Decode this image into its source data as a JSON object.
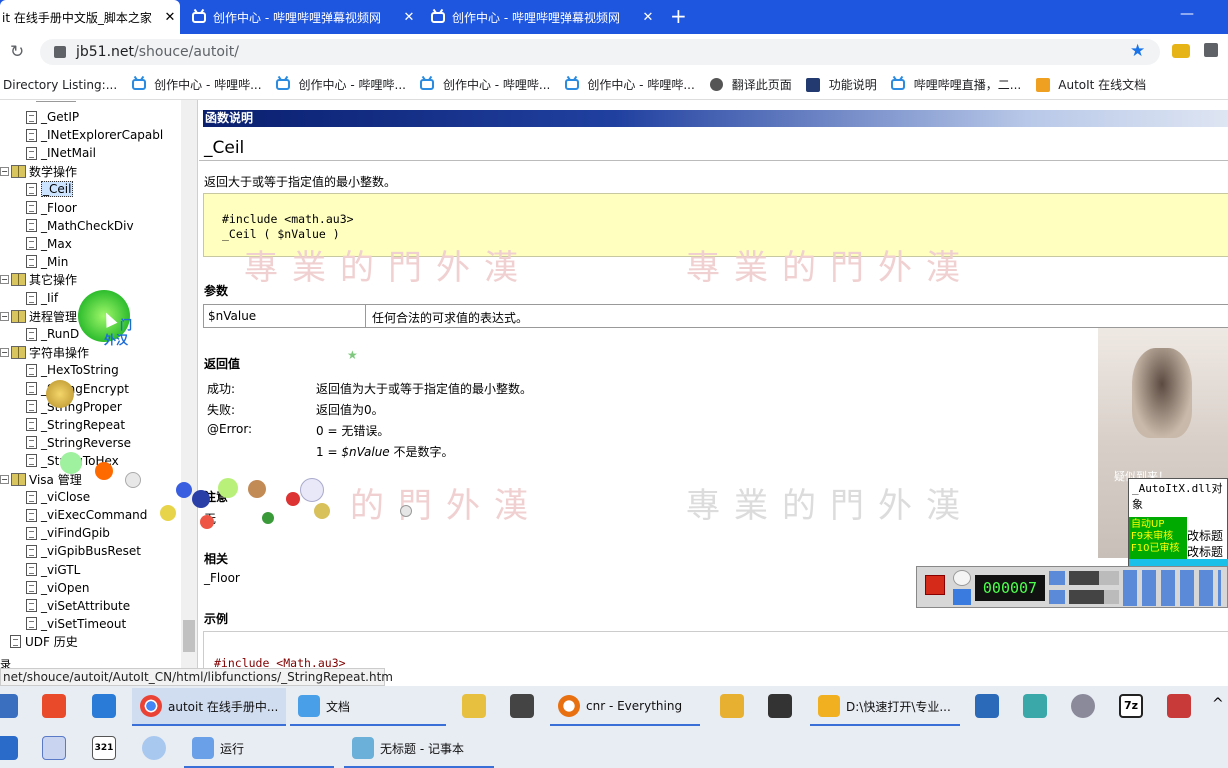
{
  "browser": {
    "tabs": [
      {
        "label": "it 在线手册中文版_脚本之家",
        "close": "✕",
        "active": true
      },
      {
        "label": "创作中心 - 哔哩哔哩弹幕视频网",
        "close": "✕",
        "active": false
      },
      {
        "label": "创作中心 - 哔哩哔哩弹幕视频网",
        "close": "✕",
        "active": false
      }
    ],
    "new_tab": "+",
    "window_minimize": "—",
    "address": {
      "host": "jb51.net",
      "path": "/shouce/autoit/"
    },
    "bookmarks": [
      {
        "label": "Directory Listing:...",
        "icon": "none"
      },
      {
        "label": "创作中心 - 哔哩哔...",
        "icon": "bilibili-icon"
      },
      {
        "label": "创作中心 - 哔哩哔...",
        "icon": "bilibili-icon"
      },
      {
        "label": "创作中心 - 哔哩哔...",
        "icon": "bilibili-icon"
      },
      {
        "label": "创作中心 - 哔哩哔...",
        "icon": "bilibili-icon"
      },
      {
        "label": "翻译此页面",
        "icon": "translate-icon"
      },
      {
        "label": "功能说明",
        "icon": "ru-icon"
      },
      {
        "label": "哔哩哔哩直播，二...",
        "icon": "bilibili-icon"
      },
      {
        "label": "AutoIt 在线文档",
        "icon": "autoit-icon"
      }
    ]
  },
  "tree": {
    "items": [
      {
        "label": "_GetIP",
        "type": "doc"
      },
      {
        "label": "_INetExplorerCapabl",
        "type": "doc"
      },
      {
        "label": "_INetMail",
        "type": "doc"
      },
      {
        "label": "数学操作",
        "type": "folder"
      },
      {
        "label": "_Ceil",
        "type": "doc",
        "selected": true
      },
      {
        "label": "_Floor",
        "type": "doc"
      },
      {
        "label": "_MathCheckDiv",
        "type": "doc"
      },
      {
        "label": "_Max",
        "type": "doc"
      },
      {
        "label": "_Min",
        "type": "doc"
      },
      {
        "label": "其它操作",
        "type": "folder"
      },
      {
        "label": "_Iif",
        "type": "doc"
      },
      {
        "label": "进程管理",
        "type": "folder"
      },
      {
        "label": "_RunD",
        "type": "doc"
      },
      {
        "label": "字符串操作",
        "type": "folder"
      },
      {
        "label": "_HexToString",
        "type": "doc"
      },
      {
        "label": "_StringEncrypt",
        "type": "doc"
      },
      {
        "label": "_StringProper",
        "type": "doc"
      },
      {
        "label": "_StringRepeat",
        "type": "doc"
      },
      {
        "label": "_StringReverse",
        "type": "doc"
      },
      {
        "label": "_StringToHex",
        "type": "doc"
      },
      {
        "label": "Visa 管理",
        "type": "folder"
      },
      {
        "label": "_viClose",
        "type": "doc"
      },
      {
        "label": "_viExecCommand",
        "type": "doc"
      },
      {
        "label": "_viFindGpib",
        "type": "doc"
      },
      {
        "label": "_viGpibBusReset",
        "type": "doc"
      },
      {
        "label": "_viGTL",
        "type": "doc"
      },
      {
        "label": "_viOpen",
        "type": "doc"
      },
      {
        "label": "_viSetAttribute",
        "type": "doc"
      },
      {
        "label": "_viSetTimeout",
        "type": "doc"
      },
      {
        "label": "UDF 历史",
        "type": "doc"
      }
    ],
    "bottom_fragment": "录"
  },
  "doc": {
    "header": "函数说明",
    "title": "_Ceil",
    "description": "返回大于或等于指定值的最小整数。",
    "syntax_line1": "#include <math.au3>",
    "syntax_line2": "_Ceil ( $nValue )",
    "params_heading": "参数",
    "param_name": "$nValue",
    "param_desc": "任何合法的可求值的表达式。",
    "return_heading": "返回值",
    "returns": [
      {
        "key": "成功:",
        "value": "返回值为大于或等于指定值的最小整数。"
      },
      {
        "key": "失败:",
        "value": "返回值为0。"
      },
      {
        "key": "@Error:",
        "value": "0 = 无错误。"
      },
      {
        "key": "",
        "value": "1 = $nValue 不是数字。"
      }
    ],
    "remarks_heading": "注意",
    "remarks": "无",
    "related_heading": "相关",
    "related": "_Floor",
    "example_heading": "示例",
    "example_code": "#include <Math.au3>"
  },
  "overlay": {
    "watermark_top_right": "專業的門外漢",
    "watermark_top_left": "專業的門外漢",
    "watermark_mid_left": "的門外漢",
    "watermark_mid_right": "專業的門外漢",
    "cursor_caption_1": "门",
    "cursor_caption_2": "外汉",
    "side_video_caption": "疑似到来！",
    "autoit_dll": "_AutoItX.dll对象",
    "autoit_line1": "自动UP",
    "autoit_line2": "F9未审核",
    "autoit_line3": "F10已审核",
    "autoit_btn1": "改标题",
    "autoit_btn2": "改标题",
    "recorder_timer": "000007"
  },
  "status_url": "net/shouce/autoit/AutoIt_CN/html/libfunctions/_StringRepeat.htm",
  "taskbar": {
    "row1": [
      {
        "label": "autoit 在线手册中...",
        "icon": "chrome-icon"
      },
      {
        "label": "文档",
        "icon": "docs-icon"
      },
      {
        "label": "cnr - Everything",
        "icon": "everything-search-icon"
      },
      {
        "label": "D:\\快速打开\\专业...",
        "icon": "folder-icon"
      }
    ],
    "row2": [
      {
        "label": "运行",
        "icon": "run-icon"
      },
      {
        "label": "无标题 - 记事本",
        "icon": "notepad-icon"
      }
    ],
    "calendar_badge": "321",
    "sevenzip_badge": "7z"
  },
  "colors": {
    "tab_strip": "#1f56e0",
    "header_bar": "#0a1f6e",
    "code_bg": "#ffffc0",
    "selection": "#cce4ff"
  }
}
